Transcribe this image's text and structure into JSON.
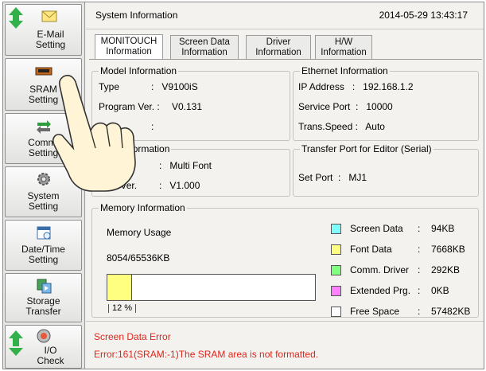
{
  "sidebar": {
    "items": [
      {
        "label_1": "E-Mail",
        "label_2": "Setting",
        "icon": "email-icon"
      },
      {
        "label_1": "SRAM",
        "label_2": "Setting",
        "icon": "sram-chip-icon"
      },
      {
        "label_1": "Comm.",
        "label_2": "Setting",
        "icon": "comm-arrows-icon"
      },
      {
        "label_1": "System",
        "label_2": "Setting",
        "icon": "gear-icon"
      },
      {
        "label_1": "Date/Time",
        "label_2": "Setting",
        "icon": "calendar-icon"
      },
      {
        "label_1": "Storage",
        "label_2": "Transfer",
        "icon": "storage-transfer-icon"
      },
      {
        "label_1": "I/O",
        "label_2": "Check",
        "icon": "io-check-icon"
      }
    ]
  },
  "header": {
    "title": "System Information",
    "datetime": "2014-05-29 13:43:17"
  },
  "tabs": [
    {
      "line1": "MONITOUCH",
      "line2": "Information"
    },
    {
      "line1": "Screen Data",
      "line2": "Information"
    },
    {
      "line1": "Driver",
      "line2": "Information"
    },
    {
      "line1": "H/W",
      "line2": "Information"
    }
  ],
  "model": {
    "legend": "Model Information",
    "type_label": "Type",
    "type_value": ":   V9100iS",
    "program_label": "Program Ver. :",
    "program_value": "V0.131",
    "third_sep": ":"
  },
  "ethernet": {
    "legend": "Ethernet Information",
    "ip": "IP Address   :   192.168.1.2",
    "port": "Service Port  :   10000",
    "speed": "Trans.Speed :   Auto"
  },
  "font": {
    "legend": "Font Information",
    "name_value": ":   Multi Font",
    "ver_label": "Font Ver.",
    "ver_value": ":   V1.000"
  },
  "transfer": {
    "legend": "Transfer Port for Editor (Serial)",
    "set_port": "Set Port  :   MJ1"
  },
  "memory": {
    "legend": "Memory Information",
    "usage_label": "Memory Usage",
    "usage_value": "8054/65536KB",
    "usage_percent": 12,
    "usage_percent_label": "12 %",
    "items": [
      {
        "name": "Screen Data",
        "value": "94KB",
        "color": "#80ffff"
      },
      {
        "name": "Font Data",
        "value": "7668KB",
        "color": "#ffff80"
      },
      {
        "name": "Comm. Driver",
        "value": "292KB",
        "color": "#80ff80"
      },
      {
        "name": "Extended Prg.",
        "value": "0KB",
        "color": "#ff80ff"
      },
      {
        "name": "Free Space",
        "value": "57482KB",
        "color": "#ffffff"
      }
    ]
  },
  "error": {
    "title": "Screen Data Error",
    "message": "Error:161(SRAM:-1)The SRAM area is not formatted."
  }
}
